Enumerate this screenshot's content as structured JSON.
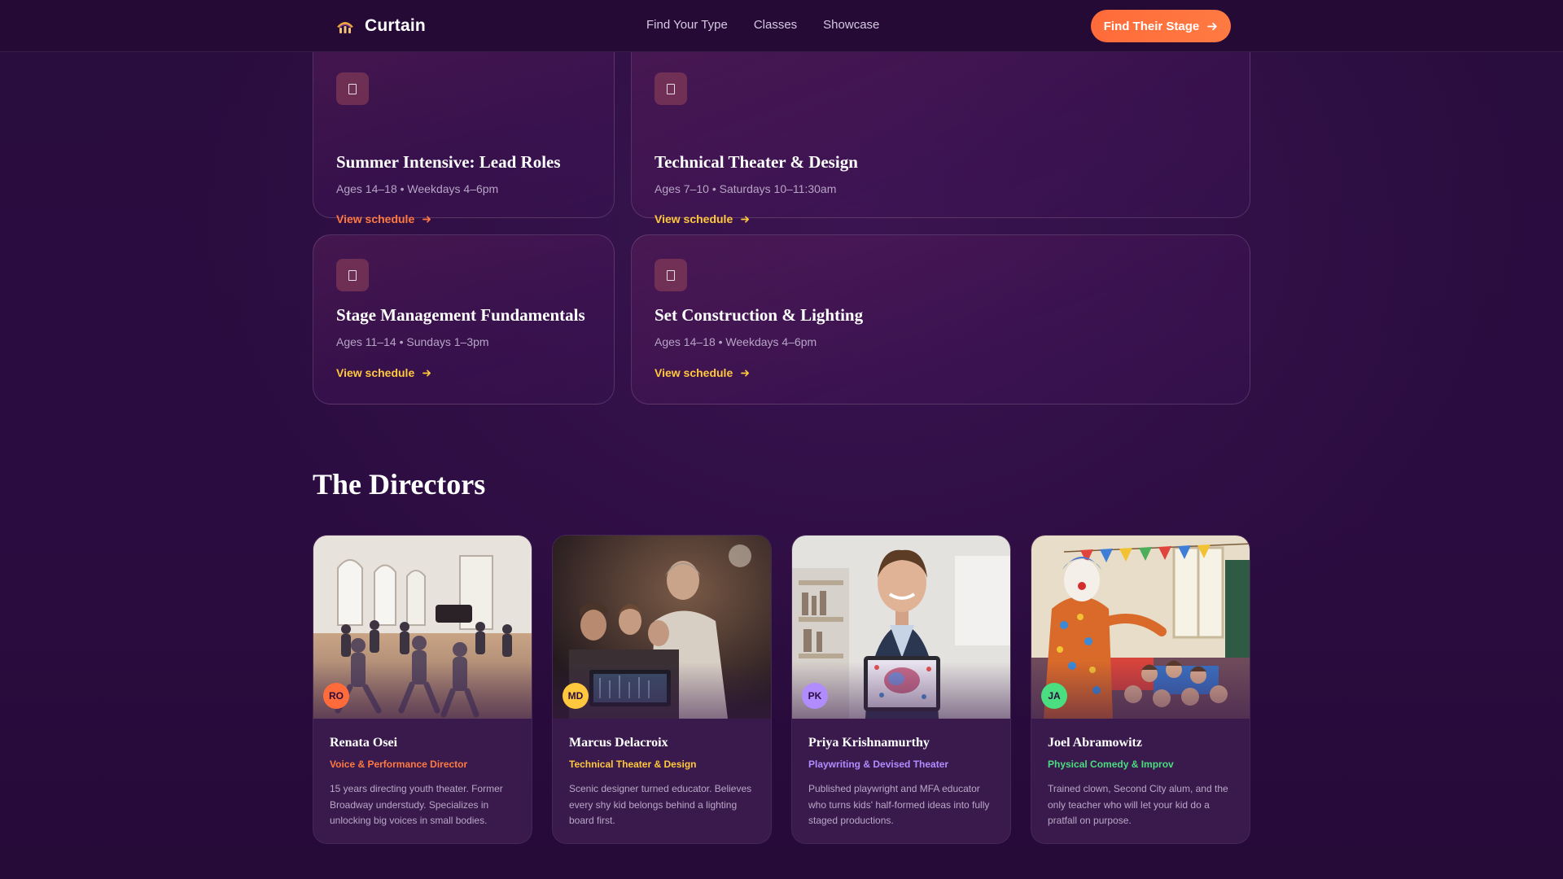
{
  "nav": {
    "brand": "Curtain",
    "links": [
      "Find Your Type",
      "Classes",
      "Showcase"
    ],
    "cta_label": "Find Their Stage"
  },
  "classes": [
    {
      "title": "Summer Intensive: Lead Roles",
      "meta": "Ages 14–18 • Weekdays 4–6pm",
      "link": "View schedule",
      "accent": "#ff7a42"
    },
    {
      "title": "Technical Theater & Design",
      "meta": "Ages 7–10 • Saturdays 10–11:30am",
      "link": "View schedule",
      "accent": "#ffc83d"
    },
    {
      "title": "Stage Management Fundamentals",
      "meta": "Ages 11–14 • Sundays 1–3pm",
      "link": "View schedule",
      "accent": "#ffc83d"
    },
    {
      "title": "Set Construction & Lighting",
      "meta": "Ages 14–18 • Weekdays 4–6pm",
      "link": "View schedule",
      "accent": "#ffc83d"
    }
  ],
  "directors_section": {
    "title": "The Directors",
    "directors": [
      {
        "initials": "RO",
        "name": "Renata Osei",
        "role": "Voice & Performance Director",
        "bio": "15 years directing youth theater. Former Broadway understudy. Specializes in unlocking big voices in small bodies.",
        "color": "#ff6b3a"
      },
      {
        "initials": "MD",
        "name": "Marcus Delacroix",
        "role": "Technical Theater & Design",
        "bio": "Scenic designer turned educator. Believes every shy kid belongs behind a lighting board first.",
        "color": "#ffc83d"
      },
      {
        "initials": "PK",
        "name": "Priya Krishnamurthy",
        "role": "Playwriting & Devised Theater",
        "bio": "Published playwright and MFA educator who turns kids' half-formed ideas into fully staged productions.",
        "color": "#b18cff"
      },
      {
        "initials": "JA",
        "name": "Joel Abramowitz",
        "role": "Physical Comedy & Improv",
        "bio": "Trained clown, Second City alum, and the only teacher who will let your kid do a pratfall on purpose.",
        "color": "#4ade80"
      }
    ]
  },
  "icons": {
    "brand": "theater-masks-icon",
    "class_card": "document-icon",
    "link_arrow": "arrow-right-icon"
  }
}
